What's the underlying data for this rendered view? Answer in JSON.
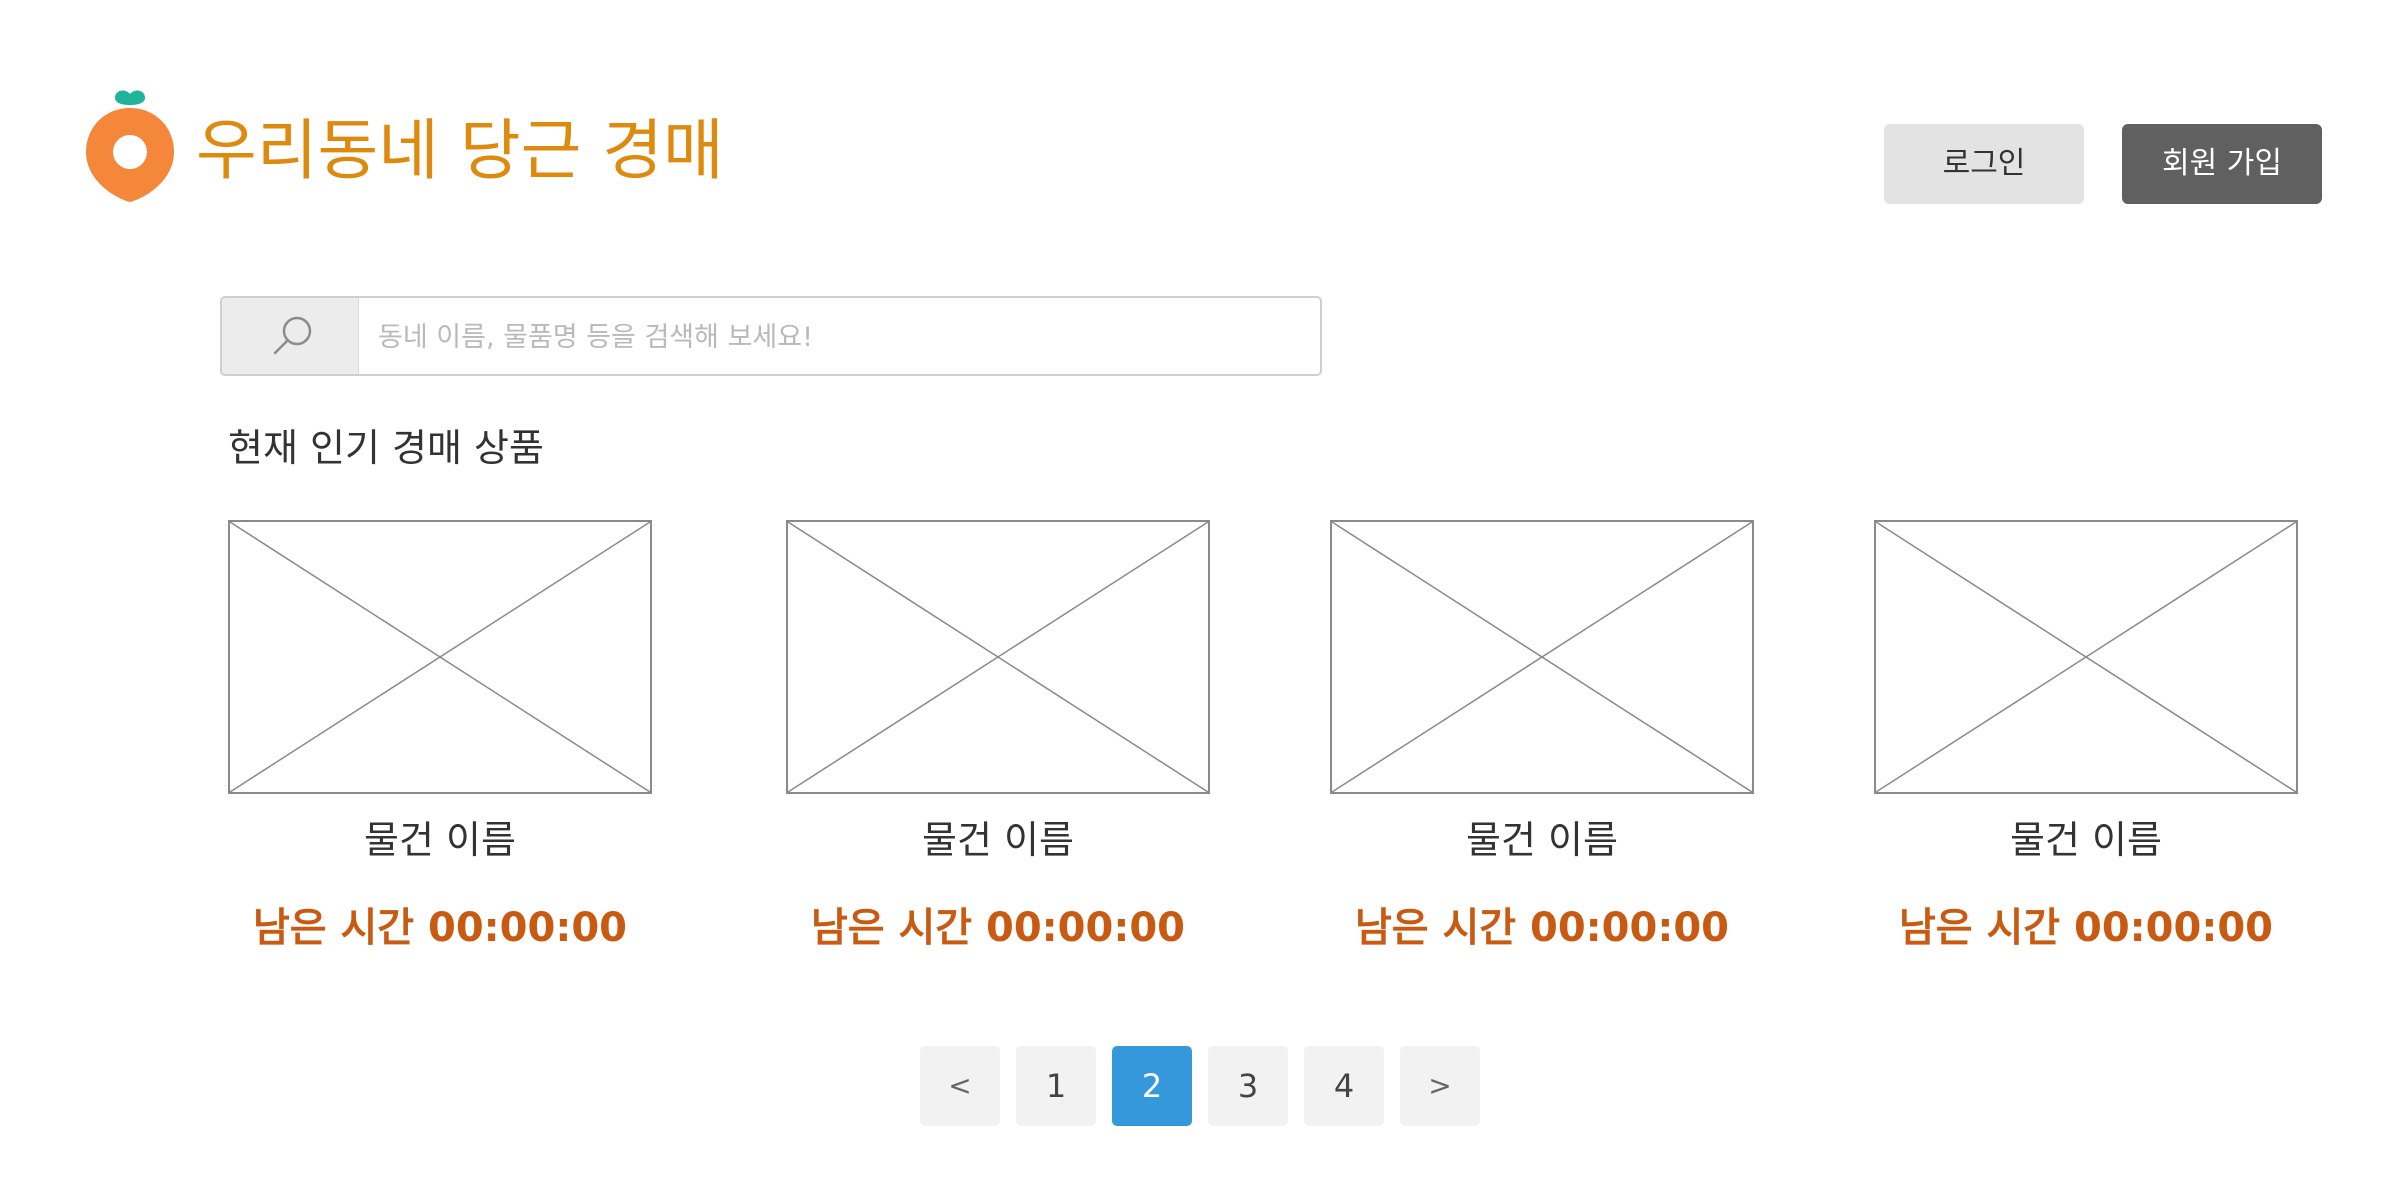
{
  "header": {
    "brand": "우리동네 당근 경매",
    "login_label": "로그인",
    "signup_label": "회원 가입"
  },
  "search": {
    "placeholder": "동네 이름, 물품명 등을 검색해 보세요!",
    "value": ""
  },
  "section": {
    "title": "현재 인기 경매 상품"
  },
  "products": [
    {
      "name": "물건 이름",
      "time_label": "남은 시간 00:00:00"
    },
    {
      "name": "물건 이름",
      "time_label": "남은 시간 00:00:00"
    },
    {
      "name": "물건 이름",
      "time_label": "남은 시간 00:00:00"
    },
    {
      "name": "물건 이름",
      "time_label": "남은 시간 00:00:00"
    }
  ],
  "pagination": {
    "prev": "<",
    "pages": [
      "1",
      "2",
      "3",
      "4"
    ],
    "next": ">",
    "current": "2"
  },
  "icons": {
    "logo": "carrot-logo-icon",
    "search": "search-icon",
    "image_placeholder": "image-placeholder-icon"
  },
  "colors": {
    "brand": "#dd8a0f",
    "carrot": "#f5873b",
    "leaf": "#1fb39a",
    "timer": "#c85a12",
    "active_page": "#3498db",
    "signup_button": "#606060",
    "login_button": "#e3e3e3"
  }
}
